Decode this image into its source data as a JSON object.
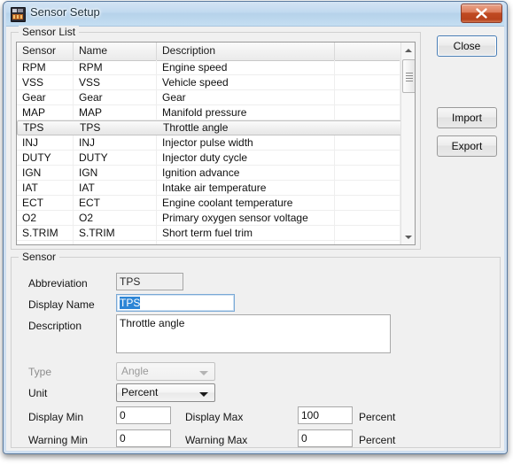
{
  "window": {
    "title": "Sensor Setup",
    "app_icon": "sensor-app-icon",
    "close_tooltip": "Close"
  },
  "sensor_list": {
    "group_label": "Sensor List",
    "columns": [
      "Sensor",
      "Name",
      "Description",
      ""
    ],
    "rows": [
      {
        "sensor": "RPM",
        "name": "RPM",
        "description": "Engine speed",
        "extra": "",
        "selected": false
      },
      {
        "sensor": "VSS",
        "name": "VSS",
        "description": "Vehicle speed",
        "extra": "",
        "selected": false
      },
      {
        "sensor": "Gear",
        "name": "Gear",
        "description": "Gear",
        "extra": "",
        "selected": false
      },
      {
        "sensor": "MAP",
        "name": "MAP",
        "description": "Manifold pressure",
        "extra": "",
        "selected": false
      },
      {
        "sensor": "TPS",
        "name": "TPS",
        "description": "Throttle angle",
        "extra": "",
        "selected": true
      },
      {
        "sensor": "INJ",
        "name": "INJ",
        "description": "Injector pulse width",
        "extra": "",
        "selected": false
      },
      {
        "sensor": "DUTY",
        "name": "DUTY",
        "description": "Injector duty cycle",
        "extra": "",
        "selected": false
      },
      {
        "sensor": "IGN",
        "name": "IGN",
        "description": "Ignition advance",
        "extra": "",
        "selected": false
      },
      {
        "sensor": "IAT",
        "name": "IAT",
        "description": "Intake air temperature",
        "extra": "",
        "selected": false
      },
      {
        "sensor": "ECT",
        "name": "ECT",
        "description": "Engine coolant temperature",
        "extra": "",
        "selected": false
      },
      {
        "sensor": "O2",
        "name": "O2",
        "description": "Primary oxygen sensor voltage",
        "extra": "",
        "selected": false
      },
      {
        "sensor": "S.TRIM",
        "name": "S.TRIM",
        "description": "Short term fuel trim",
        "extra": "",
        "selected": false
      },
      {
        "sensor": "",
        "name": "",
        "description": "",
        "extra": "",
        "selected": false
      }
    ],
    "scrollbar": {
      "up_icon": "triangle-up-icon",
      "down_icon": "triangle-down-icon"
    }
  },
  "buttons": {
    "close": "Close",
    "import": "Import",
    "export": "Export"
  },
  "sensor_detail": {
    "group_label": "Sensor",
    "abbreviation": {
      "label": "Abbreviation",
      "value": "TPS"
    },
    "display_name": {
      "label": "Display Name",
      "value": "TPS"
    },
    "description": {
      "label": "Description",
      "value": "Throttle angle"
    },
    "type": {
      "label": "Type",
      "value": "Angle"
    },
    "unit": {
      "label": "Unit",
      "value": "Percent"
    },
    "display_min": {
      "label": "Display Min",
      "value": "0"
    },
    "display_max": {
      "label": "Display Max",
      "value": "100",
      "unit_suffix": "Percent"
    },
    "warning_min": {
      "label": "Warning Min",
      "value": "0"
    },
    "warning_max": {
      "label": "Warning Max",
      "value": "0",
      "unit_suffix": "Percent"
    }
  },
  "colors": {
    "titlebar": "#c2daf0",
    "window_bg": "#f0f0f0",
    "close_button": "#c04a22",
    "selection": "#2c85d6",
    "focus_border": "#4a7eb5"
  }
}
